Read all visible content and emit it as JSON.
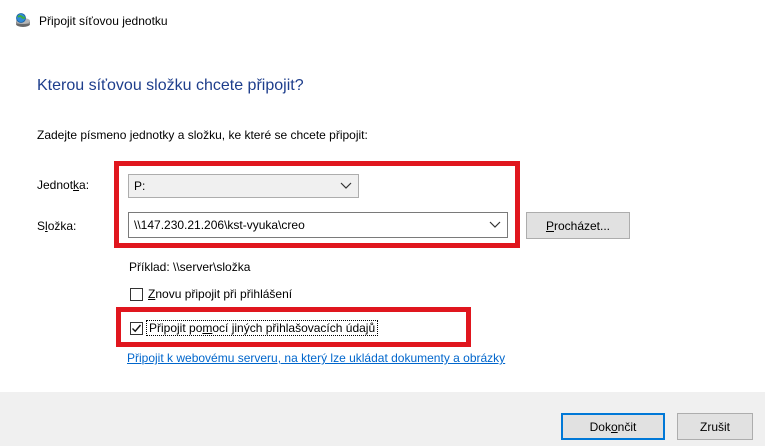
{
  "window": {
    "title": "Připojit síťovou jednotku"
  },
  "main": {
    "heading": "Kterou síťovou složku chcete připojit?",
    "instruction": "Zadejte písmeno jednotky a složku, ke které se chcete připojit:",
    "drive": {
      "label_pre": "Jednot",
      "label_key": "k",
      "label_post": "a:",
      "value": "P:"
    },
    "folder": {
      "label_pre": "S",
      "label_key": "l",
      "label_post": "ožka:",
      "value": "\\\\147.230.21.206\\kst-vyuka\\creo"
    },
    "browse": {
      "label_key": "P",
      "label_post": "rocházet..."
    },
    "example": "Příklad: \\\\server\\složka",
    "reconnect": {
      "checked": false,
      "label_key": "Z",
      "label_post": "novu připojit při přihlášení"
    },
    "other_credentials": {
      "checked": true,
      "label_pre": "Připojit po",
      "label_key": "m",
      "label_post": "ocí jiných přihlašovacích údajů"
    },
    "web_link": "Připojit k webovému serveru, na který lze ukládat dokumenty a obrázky"
  },
  "footer": {
    "finish": {
      "label_pre": "Dok",
      "label_key": "o",
      "label_post": "nčit"
    },
    "cancel_label": "Zrušit"
  },
  "colors": {
    "heading": "#1e3e8c",
    "highlight": "#e0161e",
    "link": "#0066cc",
    "focus": "#0078d7"
  },
  "icons": {
    "title": "network-drive-icon",
    "dropdown": "chevron-down-icon",
    "checkmark": "checkmark-icon"
  }
}
